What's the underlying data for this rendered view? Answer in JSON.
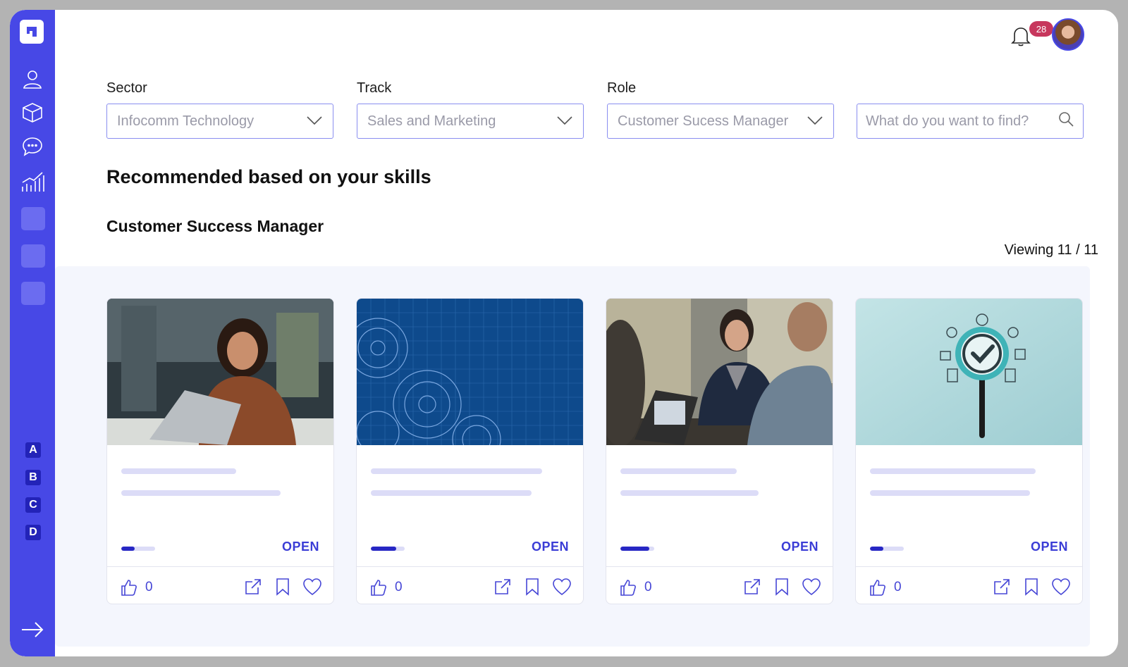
{
  "colors": {
    "brand": "#4748e6",
    "accent": "#3b3dd6",
    "badge": "#c7375d"
  },
  "sidebar": {
    "nav_icons": [
      "user-icon",
      "cube-icon",
      "chat-icon",
      "analytics-icon"
    ],
    "letters": [
      "A",
      "B",
      "C",
      "D"
    ],
    "collapse_icon": "arrow-right-icon"
  },
  "topbar": {
    "notification_count": "28"
  },
  "filters": {
    "sector": {
      "label": "Sector",
      "value": "Infocomm Technology"
    },
    "track": {
      "label": "Track",
      "value": "Sales and Marketing"
    },
    "role": {
      "label": "Role",
      "value": "Customer Sucess Manager"
    },
    "search": {
      "placeholder": "What do you want to find?"
    }
  },
  "main": {
    "heading": "Recommended based on your skills",
    "subheading": "Customer Success Manager",
    "viewing": "Viewing 11 / 11"
  },
  "cards": [
    {
      "image": "woman-with-laptop-photo",
      "progress": 0.4,
      "open_label": "OPEN",
      "likes": "0"
    },
    {
      "image": "blue-gears-blueprint",
      "progress": 0.75,
      "open_label": "OPEN",
      "likes": "0"
    },
    {
      "image": "business-meeting-photo",
      "progress": 0.85,
      "open_label": "OPEN",
      "likes": "0"
    },
    {
      "image": "magnifier-checkmark-illustration",
      "progress": 0.4,
      "open_label": "OPEN",
      "likes": "0"
    }
  ]
}
